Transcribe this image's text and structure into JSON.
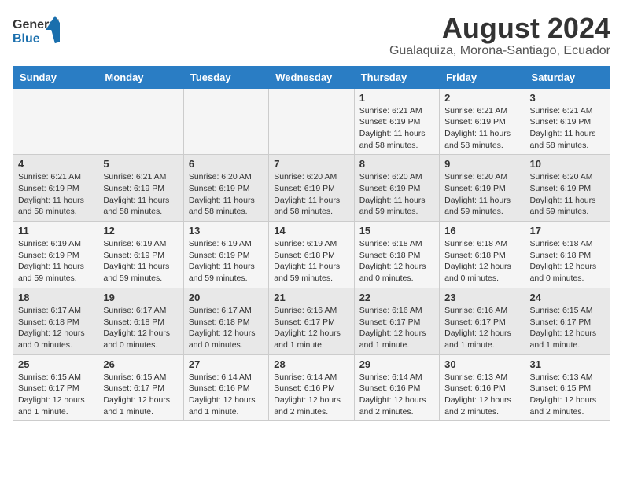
{
  "header": {
    "logo_line1": "General",
    "logo_line2": "Blue",
    "main_title": "August 2024",
    "subtitle": "Gualaquiza, Morona-Santiago, Ecuador"
  },
  "days_of_week": [
    "Sunday",
    "Monday",
    "Tuesday",
    "Wednesday",
    "Thursday",
    "Friday",
    "Saturday"
  ],
  "weeks": [
    [
      {
        "day": "",
        "info": ""
      },
      {
        "day": "",
        "info": ""
      },
      {
        "day": "",
        "info": ""
      },
      {
        "day": "",
        "info": ""
      },
      {
        "day": "1",
        "info": "Sunrise: 6:21 AM\nSunset: 6:19 PM\nDaylight: 11 hours and 58 minutes."
      },
      {
        "day": "2",
        "info": "Sunrise: 6:21 AM\nSunset: 6:19 PM\nDaylight: 11 hours and 58 minutes."
      },
      {
        "day": "3",
        "info": "Sunrise: 6:21 AM\nSunset: 6:19 PM\nDaylight: 11 hours and 58 minutes."
      }
    ],
    [
      {
        "day": "4",
        "info": "Sunrise: 6:21 AM\nSunset: 6:19 PM\nDaylight: 11 hours and 58 minutes."
      },
      {
        "day": "5",
        "info": "Sunrise: 6:21 AM\nSunset: 6:19 PM\nDaylight: 11 hours and 58 minutes."
      },
      {
        "day": "6",
        "info": "Sunrise: 6:20 AM\nSunset: 6:19 PM\nDaylight: 11 hours and 58 minutes."
      },
      {
        "day": "7",
        "info": "Sunrise: 6:20 AM\nSunset: 6:19 PM\nDaylight: 11 hours and 58 minutes."
      },
      {
        "day": "8",
        "info": "Sunrise: 6:20 AM\nSunset: 6:19 PM\nDaylight: 11 hours and 59 minutes."
      },
      {
        "day": "9",
        "info": "Sunrise: 6:20 AM\nSunset: 6:19 PM\nDaylight: 11 hours and 59 minutes."
      },
      {
        "day": "10",
        "info": "Sunrise: 6:20 AM\nSunset: 6:19 PM\nDaylight: 11 hours and 59 minutes."
      }
    ],
    [
      {
        "day": "11",
        "info": "Sunrise: 6:19 AM\nSunset: 6:19 PM\nDaylight: 11 hours and 59 minutes."
      },
      {
        "day": "12",
        "info": "Sunrise: 6:19 AM\nSunset: 6:19 PM\nDaylight: 11 hours and 59 minutes."
      },
      {
        "day": "13",
        "info": "Sunrise: 6:19 AM\nSunset: 6:19 PM\nDaylight: 11 hours and 59 minutes."
      },
      {
        "day": "14",
        "info": "Sunrise: 6:19 AM\nSunset: 6:18 PM\nDaylight: 11 hours and 59 minutes."
      },
      {
        "day": "15",
        "info": "Sunrise: 6:18 AM\nSunset: 6:18 PM\nDaylight: 12 hours and 0 minutes."
      },
      {
        "day": "16",
        "info": "Sunrise: 6:18 AM\nSunset: 6:18 PM\nDaylight: 12 hours and 0 minutes."
      },
      {
        "day": "17",
        "info": "Sunrise: 6:18 AM\nSunset: 6:18 PM\nDaylight: 12 hours and 0 minutes."
      }
    ],
    [
      {
        "day": "18",
        "info": "Sunrise: 6:17 AM\nSunset: 6:18 PM\nDaylight: 12 hours and 0 minutes."
      },
      {
        "day": "19",
        "info": "Sunrise: 6:17 AM\nSunset: 6:18 PM\nDaylight: 12 hours and 0 minutes."
      },
      {
        "day": "20",
        "info": "Sunrise: 6:17 AM\nSunset: 6:18 PM\nDaylight: 12 hours and 0 minutes."
      },
      {
        "day": "21",
        "info": "Sunrise: 6:16 AM\nSunset: 6:17 PM\nDaylight: 12 hours and 1 minute."
      },
      {
        "day": "22",
        "info": "Sunrise: 6:16 AM\nSunset: 6:17 PM\nDaylight: 12 hours and 1 minute."
      },
      {
        "day": "23",
        "info": "Sunrise: 6:16 AM\nSunset: 6:17 PM\nDaylight: 12 hours and 1 minute."
      },
      {
        "day": "24",
        "info": "Sunrise: 6:15 AM\nSunset: 6:17 PM\nDaylight: 12 hours and 1 minute."
      }
    ],
    [
      {
        "day": "25",
        "info": "Sunrise: 6:15 AM\nSunset: 6:17 PM\nDaylight: 12 hours and 1 minute."
      },
      {
        "day": "26",
        "info": "Sunrise: 6:15 AM\nSunset: 6:17 PM\nDaylight: 12 hours and 1 minute."
      },
      {
        "day": "27",
        "info": "Sunrise: 6:14 AM\nSunset: 6:16 PM\nDaylight: 12 hours and 1 minute."
      },
      {
        "day": "28",
        "info": "Sunrise: 6:14 AM\nSunset: 6:16 PM\nDaylight: 12 hours and 2 minutes."
      },
      {
        "day": "29",
        "info": "Sunrise: 6:14 AM\nSunset: 6:16 PM\nDaylight: 12 hours and 2 minutes."
      },
      {
        "day": "30",
        "info": "Sunrise: 6:13 AM\nSunset: 6:16 PM\nDaylight: 12 hours and 2 minutes."
      },
      {
        "day": "31",
        "info": "Sunrise: 6:13 AM\nSunset: 6:15 PM\nDaylight: 12 hours and 2 minutes."
      }
    ]
  ]
}
